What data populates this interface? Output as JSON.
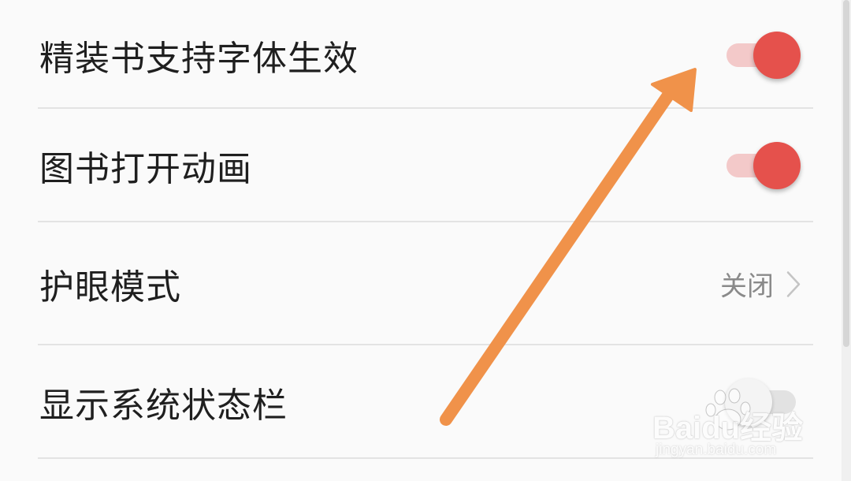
{
  "settings": [
    {
      "label": "精装书支持字体生效",
      "control": "toggle",
      "on": true
    },
    {
      "label": "图书打开动画",
      "control": "toggle",
      "on": true
    },
    {
      "label": "护眼模式",
      "control": "value",
      "value": "关闭",
      "icon": "chevron-right-icon"
    },
    {
      "label": "显示系统状态栏",
      "control": "toggle",
      "on": false
    }
  ],
  "colors": {
    "accent": "#e5514c",
    "track_on": "#f3c9c9",
    "annotation_arrow": "#f0924a",
    "divider": "#e3e3e3"
  },
  "annotation": {
    "icon": "arrow-icon",
    "points_to": "精装书支持字体生效"
  },
  "watermark": {
    "brand": "Baidu经验",
    "url": "jingyan.baidu.com",
    "icon": "paw-icon"
  }
}
